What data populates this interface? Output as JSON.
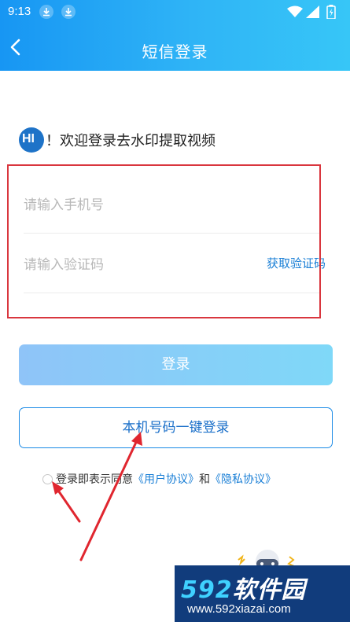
{
  "status_bar": {
    "time": "9:13"
  },
  "nav": {
    "title": "短信登录"
  },
  "greeting": {
    "badge": "HI",
    "text": "！欢迎登录去水印提取视频"
  },
  "form": {
    "phone_placeholder": "请输入手机号",
    "code_placeholder": "请输入验证码",
    "get_code_label": "获取验证码"
  },
  "buttons": {
    "login": "登录",
    "one_key_login": "本机号码一键登录"
  },
  "agreement": {
    "prefix": "登录即表示同意",
    "user_agreement": "《用户协议》",
    "and": "和",
    "privacy_agreement": "《隐私协议》"
  },
  "watermark": {
    "brand_number": "592",
    "brand_text": "软件园",
    "url": "www.592xiazai.com"
  },
  "colors": {
    "header_start": "#1796f3",
    "header_end": "#37c6f7",
    "link": "#1a7fd6",
    "annotation_red": "#d9363e",
    "login_button": "#8fc4f8"
  },
  "icons": {
    "status_left": [
      "download-icon",
      "download-icon"
    ],
    "status_right": [
      "wifi-icon",
      "signal-icon",
      "battery-icon"
    ],
    "back": "back-arrow-icon"
  }
}
